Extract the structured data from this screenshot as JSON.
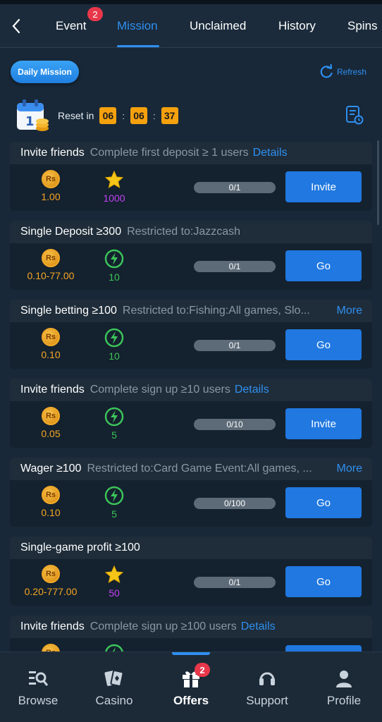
{
  "tabs": [
    {
      "label": "Event",
      "badge": "2"
    },
    {
      "label": "Mission"
    },
    {
      "label": "Unclaimed"
    },
    {
      "label": "History"
    },
    {
      "label": "Spins"
    }
  ],
  "header": {
    "daily_mission_label": "Daily Mission",
    "refresh_label": "Refresh",
    "reset_label": "Reset in",
    "timer": {
      "hours": "06",
      "minutes": "06",
      "seconds": "37"
    }
  },
  "missions": [
    {
      "title": "Invite friends",
      "desc": "Complete first deposit ≥ 1 users",
      "link": "Details",
      "more": "",
      "coin_icon": "Rs",
      "coin_value": "1.00",
      "bonus_icon": "star-icon",
      "bonus_value": "1000",
      "progress": "0/1",
      "action": "Invite"
    },
    {
      "title": "Single Deposit ≥300",
      "desc": "Restricted to:Jazzcash",
      "link": "",
      "more": "",
      "coin_icon": "Rs",
      "coin_value": "0.10-77.00",
      "bonus_icon": "lightning-icon",
      "bonus_value": "10",
      "progress": "0/1",
      "action": "Go"
    },
    {
      "title": "Single betting ≥100",
      "desc": "Restricted to:Fishing:All games, Slo...",
      "link": "",
      "more": "More",
      "coin_icon": "Rs",
      "coin_value": "0.10",
      "bonus_icon": "lightning-icon",
      "bonus_value": "10",
      "progress": "0/1",
      "action": "Go"
    },
    {
      "title": "Invite friends",
      "desc": "Complete sign up ≥10 users",
      "link": "Details",
      "more": "",
      "coin_icon": "Rs",
      "coin_value": "0.05",
      "bonus_icon": "lightning-icon",
      "bonus_value": "5",
      "progress": "0/10",
      "action": "Invite"
    },
    {
      "title": "Wager ≥100",
      "desc": "Restricted to:Card Game Event:All games, ...",
      "link": "",
      "more": "More",
      "coin_icon": "Rs",
      "coin_value": "0.10",
      "bonus_icon": "lightning-icon",
      "bonus_value": "5",
      "progress": "0/100",
      "action": "Go"
    },
    {
      "title": "Single-game profit ≥100",
      "desc": "",
      "link": "",
      "more": "",
      "coin_icon": "Rs",
      "coin_value": "0.20-777.00",
      "bonus_icon": "star-icon",
      "bonus_value": "50",
      "progress": "0/1",
      "action": "Go"
    },
    {
      "title": "Invite friends",
      "desc": "Complete sign up ≥100 users",
      "link": "Details",
      "more": "",
      "coin_icon": "Rs",
      "coin_value": "",
      "bonus_icon": "lightning-icon",
      "bonus_value": "",
      "progress": "",
      "action": ""
    }
  ],
  "bottom_nav": [
    {
      "label": "Browse",
      "icon": "browse-icon"
    },
    {
      "label": "Casino",
      "icon": "cards-icon"
    },
    {
      "label": "Offers",
      "icon": "gift-icon",
      "badge": "2"
    },
    {
      "label": "Support",
      "icon": "headset-icon"
    },
    {
      "label": "Profile",
      "icon": "person-icon"
    }
  ],
  "colors": {
    "accent": "#2f8ff0",
    "coin": "#f5a623",
    "star_value": "#c042f5",
    "lightning_value": "#3cc45a",
    "badge": "#e8374a",
    "timer_bg": "#f5a10e"
  }
}
